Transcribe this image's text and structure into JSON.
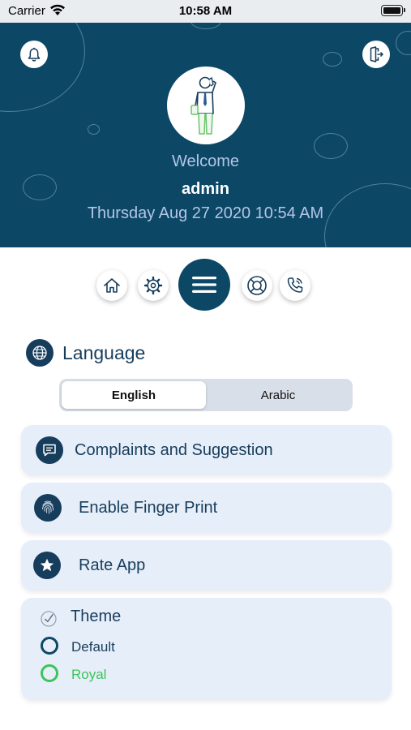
{
  "status_bar": {
    "carrier": "Carrier",
    "time": "10:58 AM"
  },
  "header": {
    "welcome": "Welcome",
    "username": "admin",
    "datetime": "Thursday Aug 27 2020 10:54 AM",
    "background_color": "#0c4866",
    "icons": {
      "left": "bell-icon",
      "right": "logout-icon",
      "avatar": "businessman-on-phone-icon"
    }
  },
  "nav": {
    "items": [
      {
        "name": "home",
        "icon": "home-icon"
      },
      {
        "name": "settings",
        "icon": "gear-icon"
      },
      {
        "name": "menu",
        "icon": "hamburger-icon"
      },
      {
        "name": "support",
        "icon": "lifebuoy-icon"
      },
      {
        "name": "call",
        "icon": "phone-icon"
      }
    ]
  },
  "language": {
    "title": "Language",
    "options": [
      "English",
      "Arabic"
    ],
    "selected": "English"
  },
  "settings": {
    "items": [
      {
        "label": "Complaints and Suggestion",
        "icon": "chat-icon"
      },
      {
        "label": "Enable Finger Print",
        "icon": "fingerprint-icon"
      },
      {
        "label": "Rate App",
        "icon": "star-icon"
      }
    ]
  },
  "theme": {
    "title": "Theme",
    "options": [
      {
        "label": "Default",
        "color": "#0c4866"
      },
      {
        "label": "Royal",
        "color": "#3dc45a"
      }
    ]
  },
  "colors": {
    "primary": "#0c4866",
    "text_dark": "#173d5c",
    "card_bg": "#e6eef9",
    "royal_green": "#3dc45a"
  }
}
